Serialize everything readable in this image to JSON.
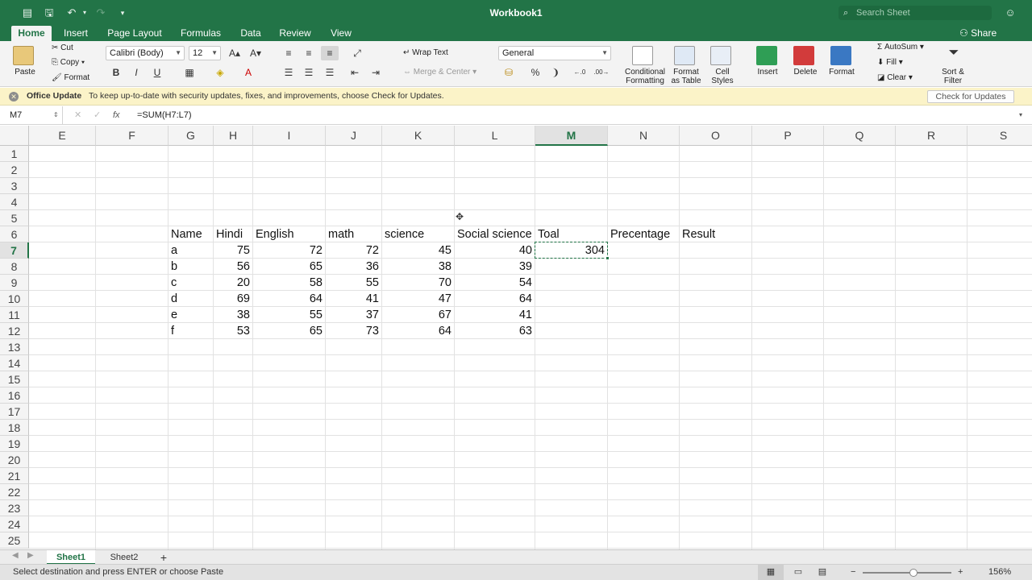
{
  "window": {
    "title": "Workbook1"
  },
  "search": {
    "placeholder": "Search Sheet"
  },
  "tabs": [
    "Home",
    "Insert",
    "Page Layout",
    "Formulas",
    "Data",
    "Review",
    "View"
  ],
  "share_label": "Share",
  "clipboard": {
    "paste": "Paste",
    "cut": "Cut",
    "copy": "Copy",
    "format": "Format"
  },
  "font": {
    "name": "Calibri (Body)",
    "size": "12"
  },
  "alignment": {
    "wrap_text": "Wrap Text",
    "merge_center": "Merge & Center"
  },
  "number": {
    "format": "General"
  },
  "styles": {
    "conditional": "Conditional\nFormatting",
    "format_table": "Format\nas Table",
    "cell_styles": "Cell\nStyles"
  },
  "cells_group": {
    "insert": "Insert",
    "delete": "Delete",
    "format": "Format"
  },
  "editing": {
    "autosum": "AutoSum",
    "fill": "Fill",
    "clear": "Clear",
    "sort_filter": "Sort &\nFilter"
  },
  "notice": {
    "title": "Office Update",
    "message": "To keep up-to-date with security updates, fixes, and improvements, choose Check for Updates.",
    "button": "Check for Updates"
  },
  "formula_bar": {
    "name_box": "M7",
    "formula": "=SUM(H7:L7)"
  },
  "columns": [
    "E",
    "F",
    "G",
    "H",
    "I",
    "J",
    "K",
    "L",
    "M",
    "N",
    "O",
    "P",
    "Q",
    "R",
    "S"
  ],
  "active_column": "M",
  "active_row": 7,
  "rows": [
    "1",
    "2",
    "3",
    "4",
    "5",
    "6",
    "7",
    "8",
    "9",
    "10",
    "11",
    "12",
    "13",
    "14",
    "15",
    "16",
    "17",
    "18",
    "19",
    "20",
    "21",
    "22",
    "23",
    "24",
    "25"
  ],
  "table": {
    "headers": [
      "Name",
      "Hindi",
      "English",
      "math",
      "science",
      "Social science",
      "Toal",
      "Precentage",
      "Result"
    ],
    "rows": [
      [
        "a",
        "75",
        "72",
        "72",
        "45",
        "40",
        "304"
      ],
      [
        "b",
        "56",
        "65",
        "36",
        "38",
        "39",
        ""
      ],
      [
        "c",
        "20",
        "58",
        "55",
        "70",
        "54",
        ""
      ],
      [
        "d",
        "69",
        "64",
        "41",
        "47",
        "64",
        ""
      ],
      [
        "e",
        "38",
        "55",
        "37",
        "67",
        "41",
        ""
      ],
      [
        "f",
        "53",
        "65",
        "73",
        "64",
        "63",
        ""
      ]
    ]
  },
  "sheets": [
    "Sheet1",
    "Sheet2"
  ],
  "status": {
    "message": "Select destination and press ENTER or choose Paste",
    "zoom": "156%"
  },
  "colors": {
    "accent": "#227447",
    "notice_bg": "#fbf3c8"
  }
}
